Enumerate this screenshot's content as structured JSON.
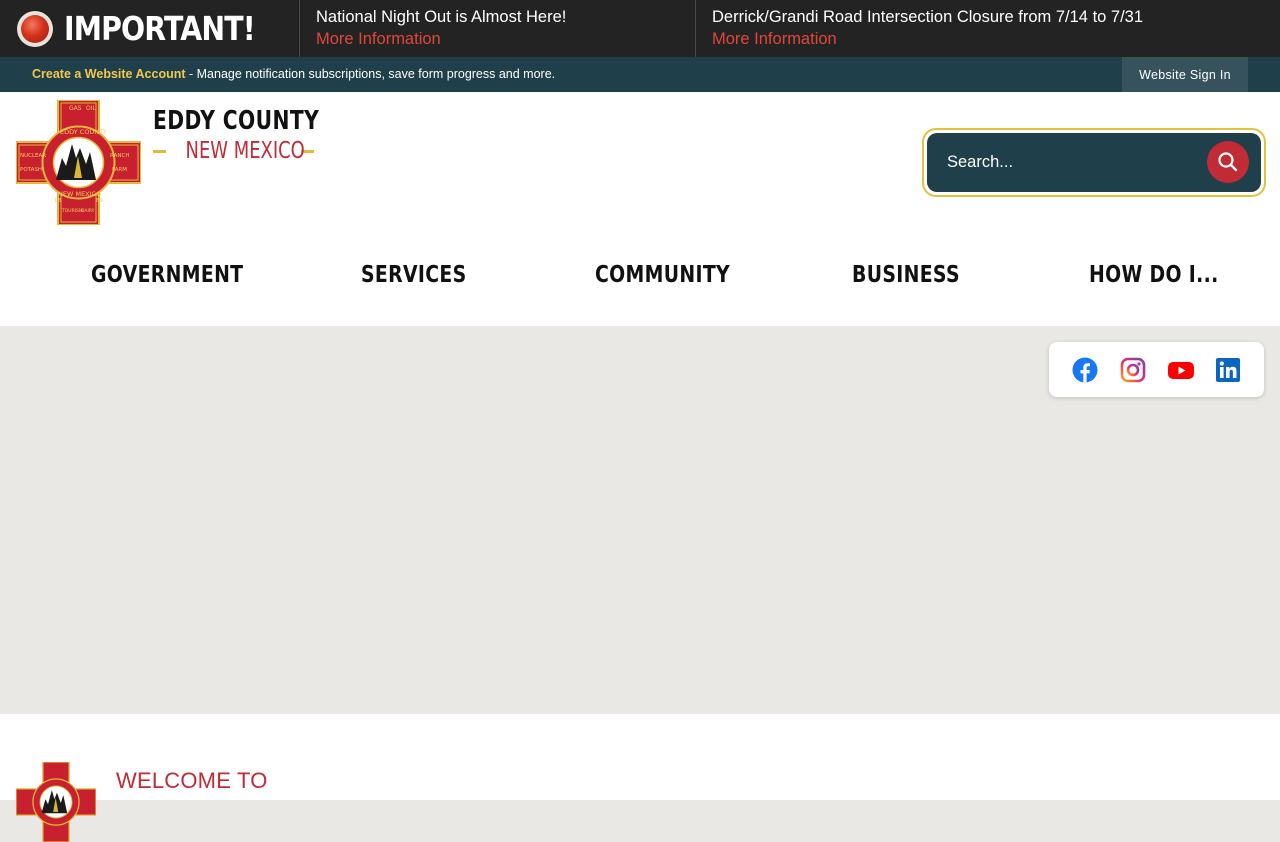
{
  "alert": {
    "label": "IMPORTANT!",
    "items": [
      {
        "text": "National Night Out is Almost Here!",
        "link": "More Information"
      },
      {
        "text": "Derrick/Grandi Road Intersection Closure from 7/14 to 7/31",
        "link": "More Information"
      }
    ]
  },
  "account_bar": {
    "create_link": "Create a Website Account",
    "description": " - Manage notification subscriptions, save form progress and more.",
    "sign_in": "Website Sign In"
  },
  "logo": {
    "line1": "EDDY COUNTY",
    "line2": "NEW MEXICO",
    "seal_text": {
      "top_left": "GAS",
      "top_right": "OIL",
      "ring_top": "EDDY COUNTY",
      "left_top": "NUCLEAR",
      "left_bottom": "POTASH",
      "right_top": "RANCH",
      "right_bottom": "FARM",
      "ring_bottom": "NEW MEXICO",
      "bottom_left": "TOURISM",
      "bottom_right": "DAIRY",
      "year_left": "18",
      "year_right": "89"
    }
  },
  "search": {
    "placeholder": "Search..."
  },
  "nav": {
    "items": [
      {
        "label": "GOVERNMENT"
      },
      {
        "label": "SERVICES"
      },
      {
        "label": "COMMUNITY"
      },
      {
        "label": "BUSINESS"
      },
      {
        "label": "HOW DO I..."
      }
    ]
  },
  "social": {
    "icons": [
      "facebook-icon",
      "instagram-icon",
      "youtube-icon",
      "linkedin-icon"
    ]
  },
  "welcome": {
    "title": "WELCOME TO"
  },
  "colors": {
    "alert_bg": "#232323",
    "account_bar_bg": "#1f3f4b",
    "accent_red": "#c12b36",
    "accent_gold": "#e2c33c",
    "link_red": "#e0473a"
  }
}
